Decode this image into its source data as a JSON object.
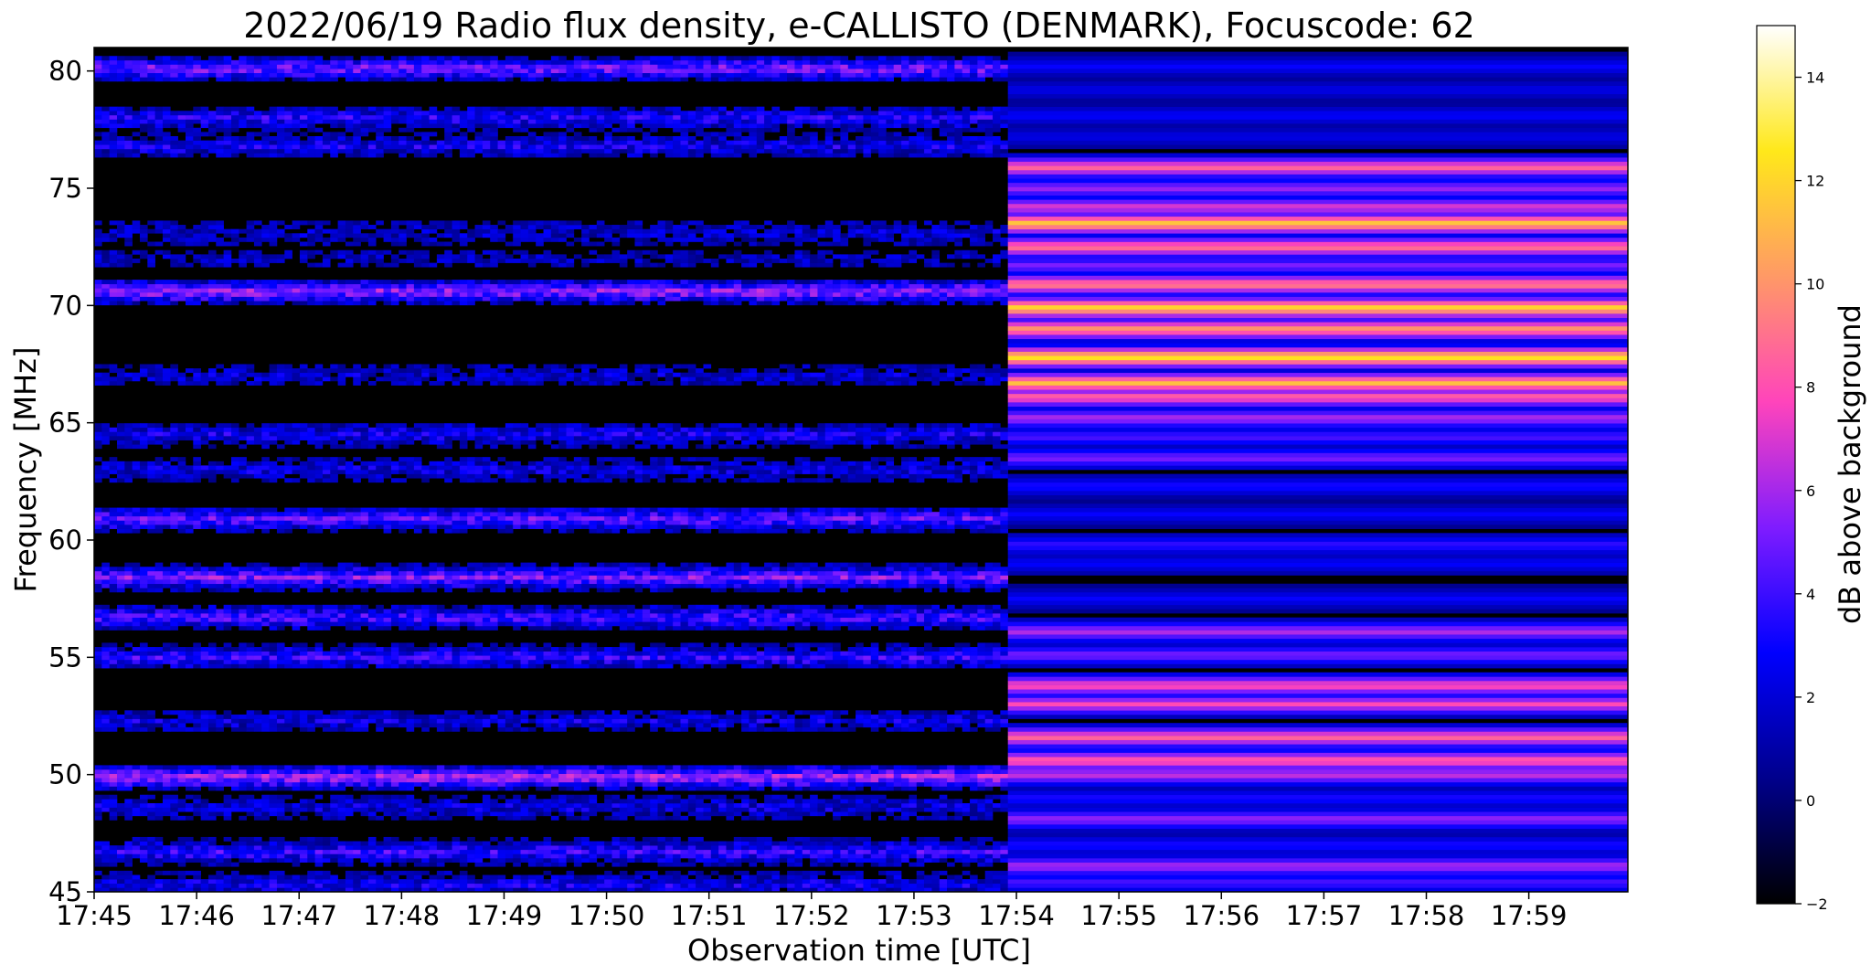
{
  "chart_data": {
    "type": "heatmap",
    "title": "2022/06/19  Radio flux density, e-CALLISTO (DENMARK), Focuscode: 62",
    "xlabel": "Observation time [UTC]",
    "ylabel": "Frequency [MHz]",
    "x_range": [
      "17:45",
      "17:59:58"
    ],
    "ylim": [
      45,
      81
    ],
    "x_ticks": [
      "17:45",
      "17:46",
      "17:47",
      "17:48",
      "17:49",
      "17:50",
      "17:51",
      "17:52",
      "17:53",
      "17:54",
      "17:55",
      "17:56",
      "17:57",
      "17:58",
      "17:59"
    ],
    "y_ticks": [
      45,
      50,
      55,
      60,
      65,
      70,
      75,
      80
    ],
    "colorbar": {
      "label": "dB above background",
      "range": [
        -2,
        15
      ],
      "ticks": [
        -2,
        0,
        2,
        4,
        6,
        8,
        10,
        12,
        14
      ],
      "colormap": "gnuplot2",
      "stops": [
        "#000000",
        "#00008c",
        "#0000ff",
        "#7f1cff",
        "#ff44bb",
        "#ff9966",
        "#ffe81a",
        "#ffffff"
      ]
    },
    "regime_change_time": "17:53:55",
    "band_profile_before": [
      {
        "f": 80.1,
        "db": 5.5
      },
      {
        "f": 78.0,
        "db": 3.5
      },
      {
        "f": 76.8,
        "db": 3.0
      },
      {
        "f": 73.1,
        "db": 2.0
      },
      {
        "f": 72.0,
        "db": 1.5
      },
      {
        "f": 70.6,
        "db": 6.0
      },
      {
        "f": 67.0,
        "db": 2.0
      },
      {
        "f": 64.5,
        "db": 3.0
      },
      {
        "f": 63.0,
        "db": 2.5
      },
      {
        "f": 60.9,
        "db": 5.0
      },
      {
        "f": 58.4,
        "db": 5.5
      },
      {
        "f": 56.7,
        "db": 4.5
      },
      {
        "f": 55.0,
        "db": 4.0
      },
      {
        "f": 52.3,
        "db": 2.5
      },
      {
        "f": 49.9,
        "db": 6.5
      },
      {
        "f": 48.6,
        "db": 2.5
      },
      {
        "f": 46.7,
        "db": 4.0
      },
      {
        "f": 45.3,
        "db": 3.0
      }
    ],
    "band_profile_after": [
      {
        "f": 80.2,
        "db": 3.0
      },
      {
        "f": 79.2,
        "db": 2.5
      },
      {
        "f": 78.1,
        "db": 3.0
      },
      {
        "f": 77.2,
        "db": 2.5
      },
      {
        "f": 75.9,
        "db": 9.0
      },
      {
        "f": 75.0,
        "db": 6.0
      },
      {
        "f": 74.2,
        "db": 7.5
      },
      {
        "f": 73.5,
        "db": 12.0
      },
      {
        "f": 72.5,
        "db": 9.5
      },
      {
        "f": 71.7,
        "db": 5.5
      },
      {
        "f": 70.9,
        "db": 10.0
      },
      {
        "f": 69.9,
        "db": 12.5
      },
      {
        "f": 69.0,
        "db": 10.5
      },
      {
        "f": 67.8,
        "db": 13.0
      },
      {
        "f": 66.7,
        "db": 11.5
      },
      {
        "f": 66.1,
        "db": 9.0
      },
      {
        "f": 65.2,
        "db": 6.5
      },
      {
        "f": 64.4,
        "db": 4.5
      },
      {
        "f": 63.5,
        "db": 5.5
      },
      {
        "f": 62.3,
        "db": 3.5
      },
      {
        "f": 61.1,
        "db": 3.0
      },
      {
        "f": 59.8,
        "db": 4.0
      },
      {
        "f": 59.0,
        "db": 3.0
      },
      {
        "f": 57.5,
        "db": 3.0
      },
      {
        "f": 56.1,
        "db": 6.5
      },
      {
        "f": 55.1,
        "db": 5.5
      },
      {
        "f": 53.8,
        "db": 8.5
      },
      {
        "f": 53.0,
        "db": 8.0
      },
      {
        "f": 51.6,
        "db": 9.0
      },
      {
        "f": 50.6,
        "db": 9.0
      },
      {
        "f": 50.0,
        "db": 7.0
      },
      {
        "f": 49.0,
        "db": 3.5
      },
      {
        "f": 48.1,
        "db": 6.0
      },
      {
        "f": 47.0,
        "db": 3.5
      },
      {
        "f": 46.1,
        "db": 6.5
      },
      {
        "f": 45.4,
        "db": 4.5
      }
    ]
  }
}
